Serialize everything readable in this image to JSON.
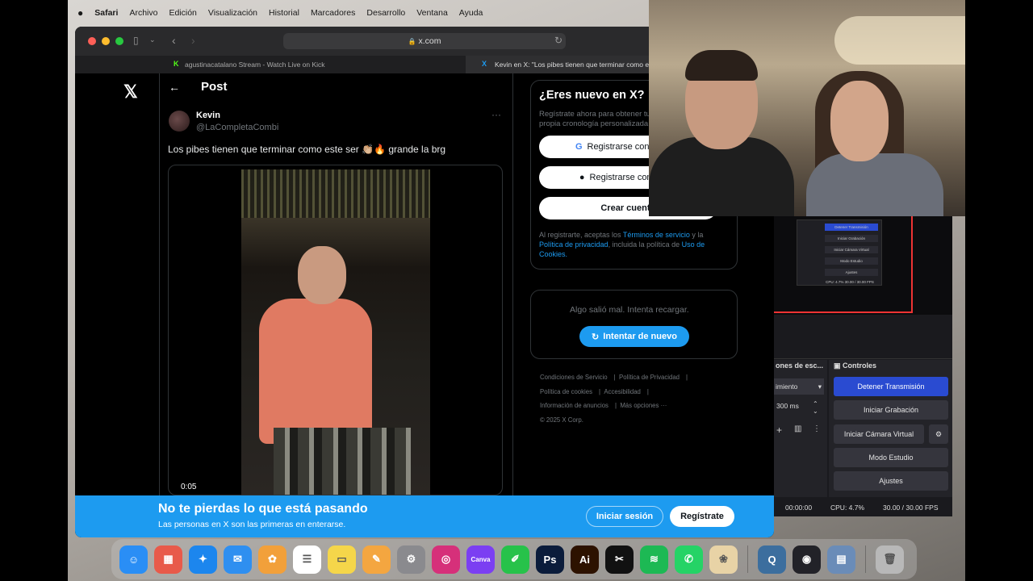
{
  "menubar": {
    "apple": "",
    "app": "Safari",
    "items": [
      "Archivo",
      "Edición",
      "Visualización",
      "Historial",
      "Marcadores",
      "Desarrollo",
      "Ventana",
      "Ayuda"
    ]
  },
  "browser": {
    "url": "x.com",
    "tabs": [
      {
        "label": "agustinacatalano Stream - Watch Live on Kick",
        "favicon": "K"
      },
      {
        "label": "Kevin en X: \"Los pibes tienen que terminar como este ser 👏🏼🔥 g",
        "favicon": "X"
      }
    ]
  },
  "x": {
    "logo": "𝕏",
    "post_header": {
      "back": "←",
      "title": "Post"
    },
    "author": {
      "name": "Kevin",
      "handle": "@LaCompletaCombi"
    },
    "more": "···",
    "post_text": "Los pibes tienen que terminar como este ser 👏🏼🔥 grande la brg",
    "video_time": "0:05",
    "signup": {
      "title": "¿Eres nuevo en X?",
      "subtitle": "Regístrate ahora para obtener tu propia cronología personalizada.",
      "google": "Registrarse con Google",
      "apple": "Registrarse con Apple",
      "create": "Crear cuenta",
      "legal_pre": "Al registrarte, aceptas los ",
      "terms": "Términos de servicio",
      "y": " y la ",
      "privacy": "Política de privacidad",
      "incl": ", incluida la política de ",
      "cookies": "Uso de Cookies."
    },
    "error": {
      "text": "Algo salió mal. Intenta recargar.",
      "retry": "Intentar de nuevo"
    },
    "footer": [
      "Condiciones de Servicio",
      "Política de Privacidad",
      "Política de cookies",
      "Accesibilidad",
      "Información de anuncios",
      "Más opciones ···",
      "© 2025 X Corp."
    ],
    "banner": {
      "headline": "No te pierdas lo que está pasando",
      "sub": "Las personas en X son las primeras en enterarse.",
      "login": "Iniciar sesión",
      "register": "Regístrate"
    }
  },
  "obs": {
    "mini_labels": [
      "Detener Transmisión",
      "Iniciar Grabación",
      "Iniciar Cámara Virtual",
      "Modo Estudio",
      "Ajustes"
    ],
    "mini_status": "CPU: 4.7%   30.00 / 30.00 FPS",
    "sources_header": "ones de esc...",
    "transition": "imiento",
    "duration": "300 ms",
    "controls_header": "Controles",
    "buttons": [
      "Detener Transmisión",
      "Iniciar Grabación",
      "Iniciar Cámara Virtual",
      "Modo Estudio",
      "Ajustes"
    ],
    "status": {
      "time": "00:00:00",
      "cpu": "CPU: 4.7%",
      "fps": "30.00 / 30.00 FPS"
    }
  },
  "dock": {
    "apps": [
      {
        "name": "Finder",
        "glyph": "☺",
        "color": "#2a8ef5"
      },
      {
        "name": "Launchpad",
        "glyph": "▦",
        "color": "#e85a4a"
      },
      {
        "name": "Safari",
        "glyph": "✦",
        "color": "#1c86ee"
      },
      {
        "name": "Mail",
        "glyph": "✉",
        "color": "#2f8ff0"
      },
      {
        "name": "Photos",
        "glyph": "✿",
        "color": "#f2a03a"
      },
      {
        "name": "Reminders",
        "glyph": "☰",
        "color": "#ffffff"
      },
      {
        "name": "Notes",
        "glyph": "▭",
        "color": "#f5d64a"
      },
      {
        "name": "Pages",
        "glyph": "✎",
        "color": "#f4a640"
      },
      {
        "name": "System Settings",
        "glyph": "⚙",
        "color": "#8a8a8e"
      },
      {
        "name": "Instagram",
        "glyph": "◎",
        "color": "#d6307a"
      },
      {
        "name": "Canva",
        "glyph": "Canva",
        "color": "#7b3ff2"
      },
      {
        "name": "Notability",
        "glyph": "✐",
        "color": "#27c24a"
      },
      {
        "name": "Photoshop",
        "glyph": "Ps",
        "color": "#0b1c3b"
      },
      {
        "name": "Illustrator",
        "glyph": "Ai",
        "color": "#2d1200"
      },
      {
        "name": "CapCut",
        "glyph": "✂",
        "color": "#111111"
      },
      {
        "name": "Spotify",
        "glyph": "≋",
        "color": "#1db954"
      },
      {
        "name": "WhatsApp",
        "glyph": "✆",
        "color": "#25d366"
      },
      {
        "name": "Flower app",
        "glyph": "❀",
        "color": "#e8d3a6"
      },
      {
        "name": "Quicktime",
        "glyph": "Q",
        "color": "#3c6e9e"
      },
      {
        "name": "OBS",
        "glyph": "◉",
        "color": "#222228"
      },
      {
        "name": "Preview",
        "glyph": "▤",
        "color": "#6a8cb8"
      },
      {
        "name": "Trash",
        "glyph": "🗑",
        "color": "#b8b8b8"
      }
    ]
  }
}
